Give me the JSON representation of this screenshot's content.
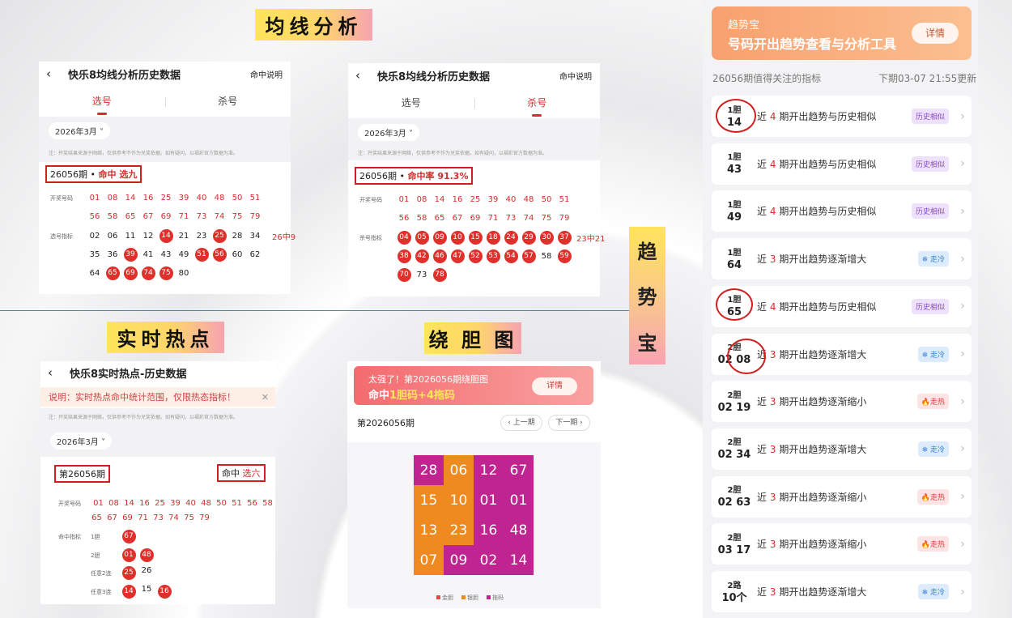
{
  "labels": {
    "ma": "均线分析",
    "hot": "实时热点",
    "rao": "绕 胆 图",
    "trend": [
      "趋",
      "势",
      "宝"
    ]
  },
  "ma1": {
    "title": "快乐8均线分析历史数据",
    "help": "命中说明",
    "tabs": [
      "选号",
      "杀号"
    ],
    "month": "2026年3月 ˅",
    "note": "注：开奖结果来源于网络，仅供参考不作为兑奖依据。如有疑问，以福彩官方数据为准。",
    "period": "26056期 • ",
    "hit": "命中 选九",
    "draw_label": "开奖号码",
    "draw1": [
      "01",
      "08",
      "14",
      "16",
      "25",
      "39",
      "40",
      "48",
      "50",
      "51"
    ],
    "draw2": [
      "56",
      "58",
      "65",
      "67",
      "69",
      "71",
      "73",
      "74",
      "75",
      "79"
    ],
    "pick_label": "选号指标",
    "pick1": [
      "02",
      "06",
      "11",
      "12",
      "14",
      "21",
      "23",
      "25",
      "28",
      "34"
    ],
    "pick2": [
      "35",
      "36",
      "39",
      "41",
      "43",
      "49",
      "51",
      "56",
      "60",
      "62"
    ],
    "pick3": [
      "64",
      "65",
      "69",
      "74",
      "75",
      "80"
    ],
    "count": "26中9"
  },
  "ma2": {
    "title": "快乐8均线分析历史数据",
    "help": "命中说明",
    "tabs": [
      "选号",
      "杀号"
    ],
    "month": "2026年3月 ˅",
    "note": "注：开奖结果来源于网络，仅供参考不作为兑奖依据。如有疑问，以福彩官方数据为准。",
    "period": "26056期 • ",
    "hit": "命中率 91.3%",
    "draw_label": "开奖号码",
    "draw1": [
      "01",
      "08",
      "14",
      "16",
      "25",
      "39",
      "40",
      "48",
      "50",
      "51"
    ],
    "draw2": [
      "56",
      "58",
      "65",
      "67",
      "69",
      "71",
      "73",
      "74",
      "75",
      "79"
    ],
    "kill_label": "杀号指标",
    "kill1": [
      "04",
      "05",
      "09",
      "10",
      "15",
      "18",
      "24",
      "29",
      "30",
      "37"
    ],
    "kill2": [
      "38",
      "42",
      "46",
      "47",
      "52",
      "53",
      "54",
      "57",
      "58",
      "59"
    ],
    "kill3": [
      "70",
      "73",
      "78"
    ],
    "count": "23中21"
  },
  "hot": {
    "title": "快乐8实时热点-历史数据",
    "explain": "说明：实时热点命中统计范围，仅限热态指标！",
    "close": "✕",
    "note": "注：开奖结果来源于网络，仅供参考不作为兑奖依据。如有疑问，以福彩官方数据为准。",
    "month": "2026年3月 ˅",
    "period": "第26056期",
    "hit_pre": "命中 ",
    "hit_val": "选六",
    "draw_label": "开奖号码",
    "draw1": [
      "01",
      "08",
      "14",
      "16",
      "25",
      "39",
      "40",
      "48",
      "50",
      "51",
      "56",
      "58"
    ],
    "draw2": [
      "65",
      "67",
      "69",
      "71",
      "73",
      "74",
      "75",
      "79"
    ],
    "ind_label": "命中指标",
    "r1l": "1胆",
    "r1": [
      "67"
    ],
    "r2l": "2胆",
    "r2": [
      "01",
      "48"
    ],
    "r3l": "任意2连",
    "r3": [
      "25",
      "26"
    ],
    "r4l": "任意3连",
    "r4": [
      "14",
      "15",
      "16"
    ]
  },
  "rao": {
    "banner_pre": "太强了！第2026056期绕胆图",
    "banner_hit_pre": "命中",
    "banner_hit": "1胆码+4拖码",
    "detail": "详情",
    "period": "第2026056期",
    "prev": "‹ 上一期",
    "next": "下一期 ›",
    "grid": [
      "28",
      "06",
      "12",
      "67",
      "15",
      "10",
      "01",
      "01",
      "13",
      "23",
      "16",
      "48",
      "07",
      "09",
      "02",
      "14"
    ],
    "legend": [
      "金胆",
      "银胆",
      "拖码"
    ]
  },
  "trend": {
    "brand": "趋势宝",
    "slogan": "号码开出趋势查看与分析工具",
    "detail": "详情",
    "header_left": "26056期值得关注的指标",
    "header_right": "下期03-07 21:55更新",
    "items": [
      {
        "d1": "1胆",
        "d2": "14",
        "pre": "近",
        "n": "4",
        "post": "期开出趋势与历史相似",
        "tag": "历史相似",
        "kind": "similar"
      },
      {
        "d1": "1胆",
        "d2": "43",
        "pre": "近",
        "n": "4",
        "post": "期开出趋势与历史相似",
        "tag": "历史相似",
        "kind": "similar"
      },
      {
        "d1": "1胆",
        "d2": "49",
        "pre": "近",
        "n": "4",
        "post": "期开出趋势与历史相似",
        "tag": "历史相似",
        "kind": "similar"
      },
      {
        "d1": "1胆",
        "d2": "64",
        "pre": "近",
        "n": "3",
        "post": "期开出趋势逐渐增大",
        "tag": "❄ 走冷",
        "kind": "cold"
      },
      {
        "d1": "1胆",
        "d2": "65",
        "pre": "近",
        "n": "4",
        "post": "期开出趋势与历史相似",
        "tag": "历史相似",
        "kind": "similar"
      },
      {
        "d1": "2胆",
        "d2": "02 08",
        "pre": "近",
        "n": "3",
        "post": "期开出趋势逐渐增大",
        "tag": "❄ 走冷",
        "kind": "cold"
      },
      {
        "d1": "2胆",
        "d2": "02 19",
        "pre": "近",
        "n": "3",
        "post": "期开出趋势逐渐缩小",
        "tag": "🔥走热",
        "kind": "hot"
      },
      {
        "d1": "2胆",
        "d2": "02 34",
        "pre": "近",
        "n": "3",
        "post": "期开出趋势逐渐增大",
        "tag": "❄ 走冷",
        "kind": "cold"
      },
      {
        "d1": "2胆",
        "d2": "02 63",
        "pre": "近",
        "n": "3",
        "post": "期开出趋势逐渐缩小",
        "tag": "🔥走热",
        "kind": "hot"
      },
      {
        "d1": "2胆",
        "d2": "03 17",
        "pre": "近",
        "n": "3",
        "post": "期开出趋势逐渐缩小",
        "tag": "🔥走热",
        "kind": "hot"
      },
      {
        "d1": "2路",
        "d2": "10个",
        "pre": "近",
        "n": "3",
        "post": "期开出趋势逐渐增大",
        "tag": "❄ 走冷",
        "kind": "cold"
      }
    ]
  }
}
